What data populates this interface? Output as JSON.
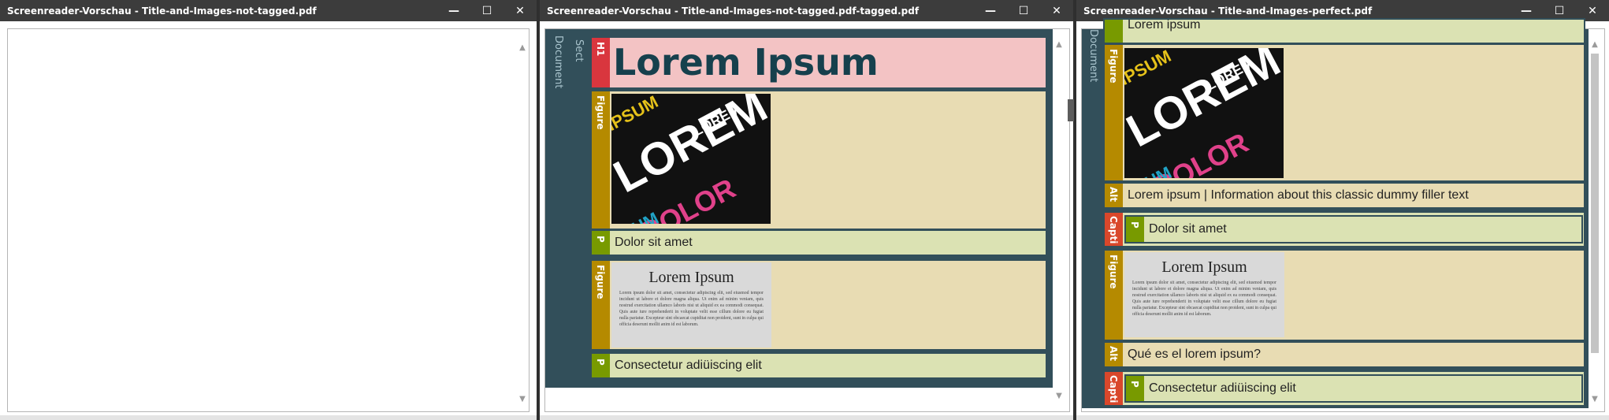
{
  "windows": [
    {
      "title": "Screenreader-Vorschau - Title-and-Images-not-tagged.pdf"
    },
    {
      "title": "Screenreader-Vorschau - Title-and-Images-not-tagged.pdf-tagged.pdf"
    },
    {
      "title": "Screenreader-Vorschau - Title-and-Images-perfect.pdf"
    }
  ],
  "controls": {
    "minimize": "—",
    "maximize": "☐",
    "close": "✕"
  },
  "tags": {
    "document": "Document",
    "sect": "Sect",
    "h1": "H1",
    "figure": "Figure",
    "p": "P",
    "alt": "Alt",
    "caption": "Capti"
  },
  "middle": {
    "heading": "Lorem Ipsum",
    "p1": "Dolor sit amet",
    "p2": "Consectetur adiüiscing elit"
  },
  "right": {
    "top_text": "Lorem ipsum",
    "alt1": "Lorem ipsum | Information about this classic dummy filler text",
    "caption1": "Dolor sit amet",
    "alt2": "Qué es el lorem ipsum?",
    "caption2": "Consectetur adiüiscing elit"
  },
  "cover_words": [
    "LOREM",
    "IPSUM",
    "DOLOR",
    "LOREM",
    "PSUM",
    "DOLOR"
  ],
  "doc_thumb": {
    "title": "Lorem Ipsum",
    "body": "Lorem ipsum dolor sit amet, consectetur adipiscing elit, sed eiusmod tempor incidunt ut labore et dolore magna aliqua. Ut enim ad minim veniam, quis nostrud exercitation ullamco laboris nisi ut aliquid ex ea commodi consequat. Quis aute iure reprehenderit in voluptate velit esse cillum dolore eu fugiat nulla pariatur. Excepteur sint obcaecat cupiditat non proident, sunt in culpa qui officia deserunt mollit anim id est laborum."
  },
  "colors": {
    "tree_bg": "#324f5a",
    "h1_strip": "#d9363e",
    "h1_body": "#f3c3c4",
    "figure_strip": "#b58a00",
    "figure_body": "#e8dcb3",
    "p_strip": "#789a00",
    "p_body": "#dbe2b3",
    "caption_strip": "#d9472b",
    "heading_text": "#16404d"
  }
}
